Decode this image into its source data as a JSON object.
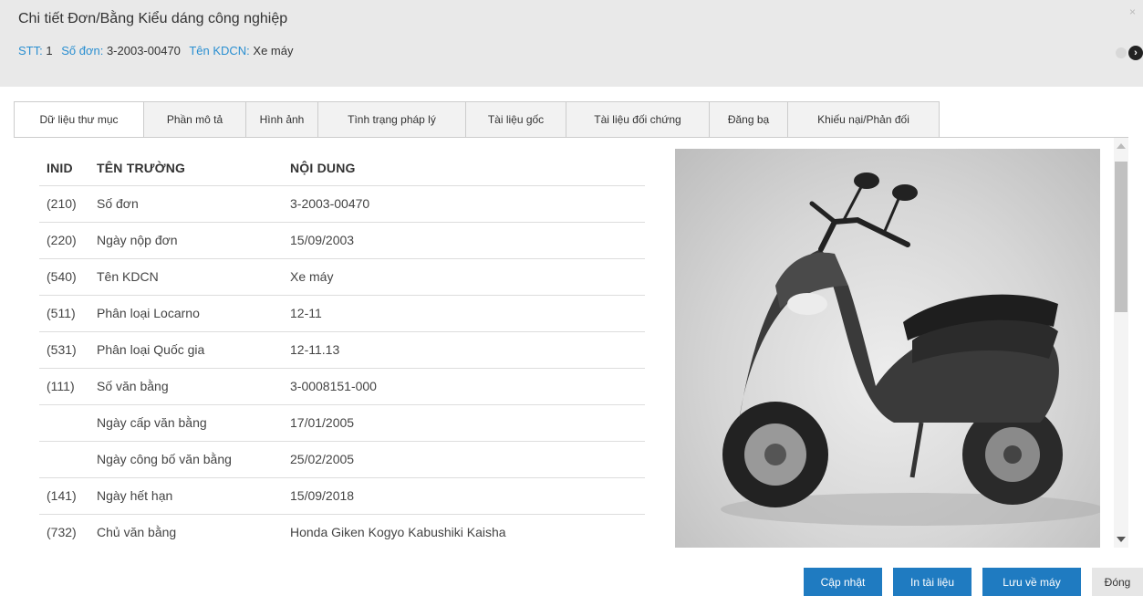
{
  "dialog": {
    "title": "Chi tiết Đơn/Bằng Kiểu dáng công nghiệp",
    "meta": {
      "stt_label": "STT:",
      "stt_value": "1",
      "so_don_label": "Số đơn:",
      "so_don_value": "3-2003-00470",
      "ten_label": "Tên KDCN:",
      "ten_value": "Xe máy"
    },
    "close_glyph": "×",
    "next_glyph": "›"
  },
  "tabs": [
    {
      "label": "Dữ liệu thư mục",
      "active": true
    },
    {
      "label": "Phần mô tả"
    },
    {
      "label": "Hình ảnh"
    },
    {
      "label": "Tình trạng pháp lý"
    },
    {
      "label": "Tài liệu gốc"
    },
    {
      "label": "Tài liệu đối chứng"
    },
    {
      "label": "Đăng bạ"
    },
    {
      "label": "Khiếu nại/Phản đối"
    }
  ],
  "table": {
    "headers": [
      "INID",
      "TÊN TRƯỜNG",
      "NỘI DUNG"
    ],
    "rows": [
      {
        "inid": "(210)",
        "field": "Số đơn",
        "value": "3-2003-00470"
      },
      {
        "inid": "(220)",
        "field": "Ngày nộp đơn",
        "value": "15/09/2003"
      },
      {
        "inid": "(540)",
        "field": "Tên KDCN",
        "value": "Xe máy"
      },
      {
        "inid": "(511)",
        "field": "Phân loại Locarno",
        "value": "12-11"
      },
      {
        "inid": "(531)",
        "field": "Phân loại Quốc gia",
        "value": "12-11.13"
      },
      {
        "inid": "(111)",
        "field": "Số văn bằng",
        "value": "3-0008151-000"
      },
      {
        "inid": "",
        "field": "Ngày cấp văn bằng",
        "value": "17/01/2005"
      },
      {
        "inid": "",
        "field": "Ngày công bố văn bằng",
        "value": "25/02/2005"
      },
      {
        "inid": "(141)",
        "field": "Ngày hết hạn",
        "value": "15/09/2018"
      },
      {
        "inid": "(732)",
        "field": "Chủ văn bằng",
        "value": "Honda Giken Kogyo Kabushiki Kaisha"
      }
    ]
  },
  "buttons": {
    "update": "Cập nhật",
    "print": "In tài liệu",
    "save": "Lưu về máy",
    "close": "Đóng"
  },
  "colors": {
    "accent": "#2a8fd1",
    "button": "#1f7bc1",
    "header_bg": "#e9e9e9"
  }
}
